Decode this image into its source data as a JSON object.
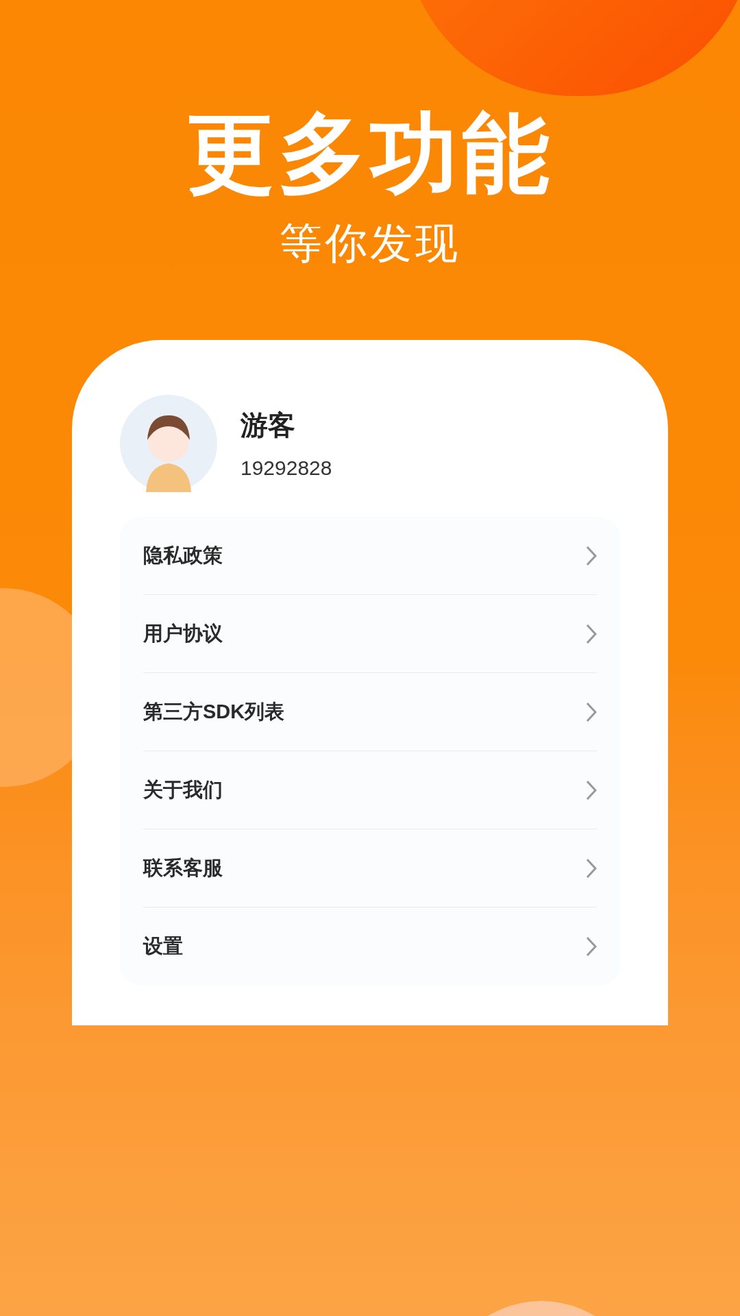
{
  "headline": "更多功能",
  "subheadline": "等你发现",
  "profile": {
    "name": "游客",
    "user_id": "19292828"
  },
  "menu": [
    {
      "label": "隐私政策"
    },
    {
      "label": "用户协议"
    },
    {
      "label": "第三方SDK列表"
    },
    {
      "label": "关于我们"
    },
    {
      "label": "联系客服"
    },
    {
      "label": "设置"
    }
  ]
}
